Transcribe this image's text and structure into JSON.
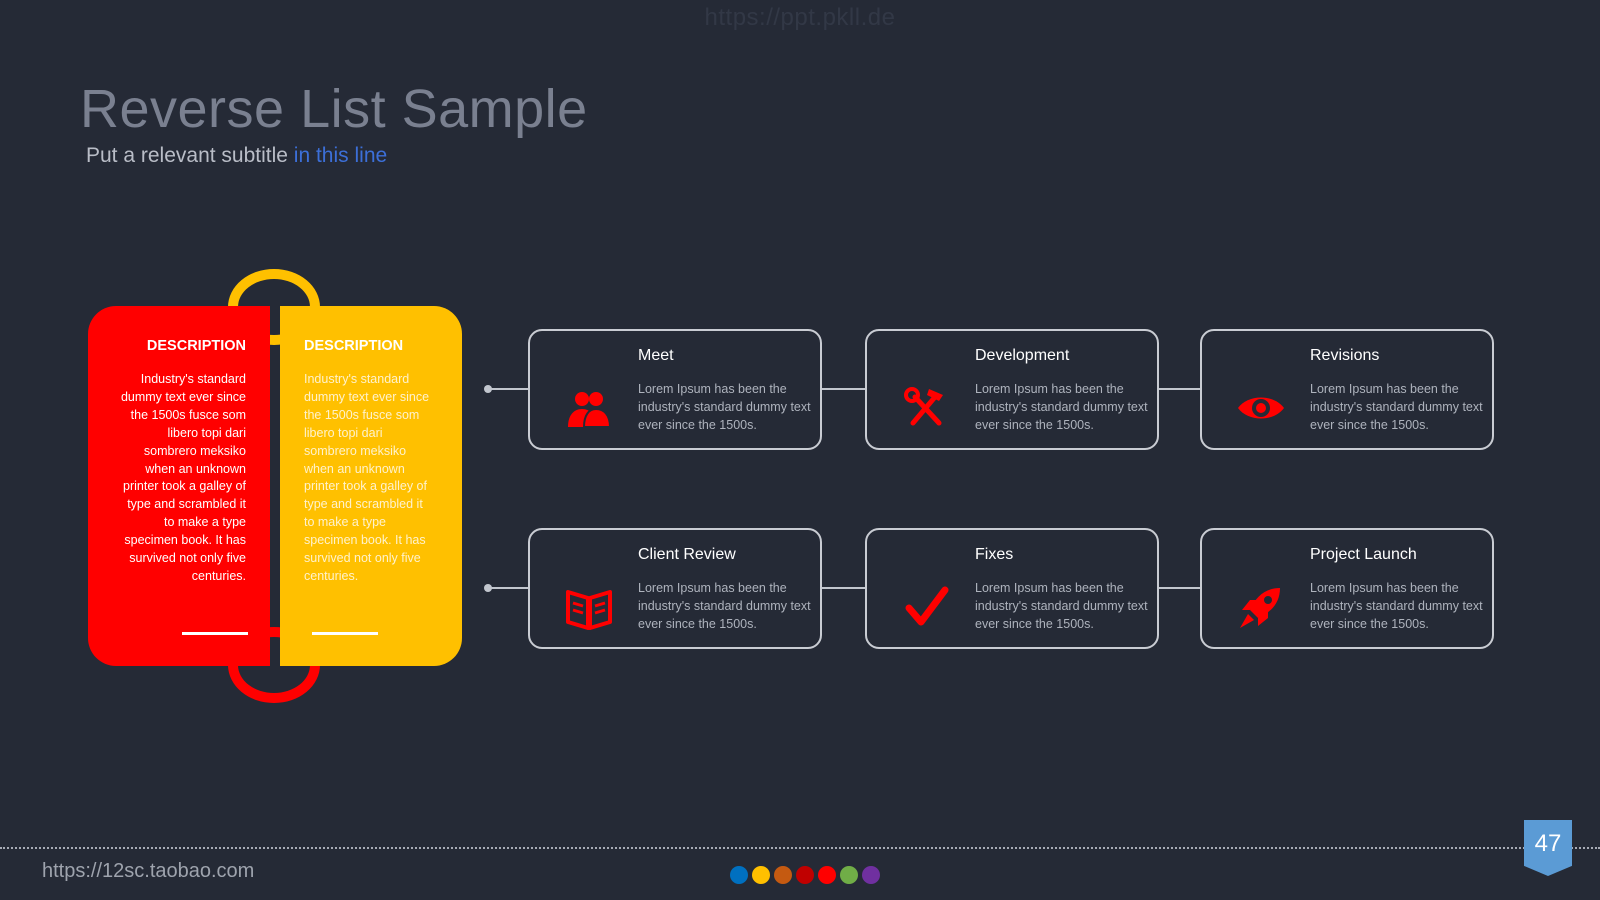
{
  "watermark": "https://ppt.pkll.de",
  "header": {
    "title": "Reverse List Sample",
    "subtitle_part1": "Put a relevant subtitle ",
    "subtitle_part2": "in this line"
  },
  "left_card": {
    "red": {
      "title": "DESCRIPTION",
      "text": "Industry's standard dummy text ever since the 1500s fusce som libero topi dari sombrero meksiko when an unknown printer took a galley of type and scrambled it to make a type specimen book. It has survived not only five centuries."
    },
    "yellow": {
      "title": "DESCRIPTION",
      "text": "Industry's standard dummy text ever since the 1500s fusce som libero topi dari sombrero meksiko when an unknown printer took a galley of type and scrambled it to make a type specimen book. It has survived not only five centuries."
    }
  },
  "steps": [
    {
      "title": "Meet",
      "text": "Lorem Ipsum has been the industry's standard dummy text ever since the 1500s.",
      "icon": "users-icon"
    },
    {
      "title": "Development",
      "text": "Lorem Ipsum has been the industry's standard dummy text ever since the 1500s.",
      "icon": "tools-icon"
    },
    {
      "title": "Revisions",
      "text": "Lorem Ipsum has been the industry's standard dummy text ever since the 1500s.",
      "icon": "eye-icon"
    },
    {
      "title": "Client Review",
      "text": "Lorem Ipsum has been the industry's standard dummy text ever since the 1500s.",
      "icon": "book-icon"
    },
    {
      "title": "Fixes",
      "text": "Lorem Ipsum has been the industry's standard dummy text ever since the 1500s.",
      "icon": "check-icon"
    },
    {
      "title": "Project Launch",
      "text": "Lorem Ipsum has been the industry's standard dummy text ever since the 1500s.",
      "icon": "rocket-icon"
    }
  ],
  "colors": {
    "background": "#252a36",
    "accent_red": "#ff0000",
    "accent_yellow": "#ffc000",
    "page_badge": "#5b9bd5"
  },
  "footer": {
    "url": "https://12sc.taobao.com",
    "page_number": "47",
    "color_dots": [
      "#0070c0",
      "#ffc000",
      "#c55a11",
      "#c00000",
      "#ff0000",
      "#70ad47",
      "#7030a0"
    ]
  }
}
